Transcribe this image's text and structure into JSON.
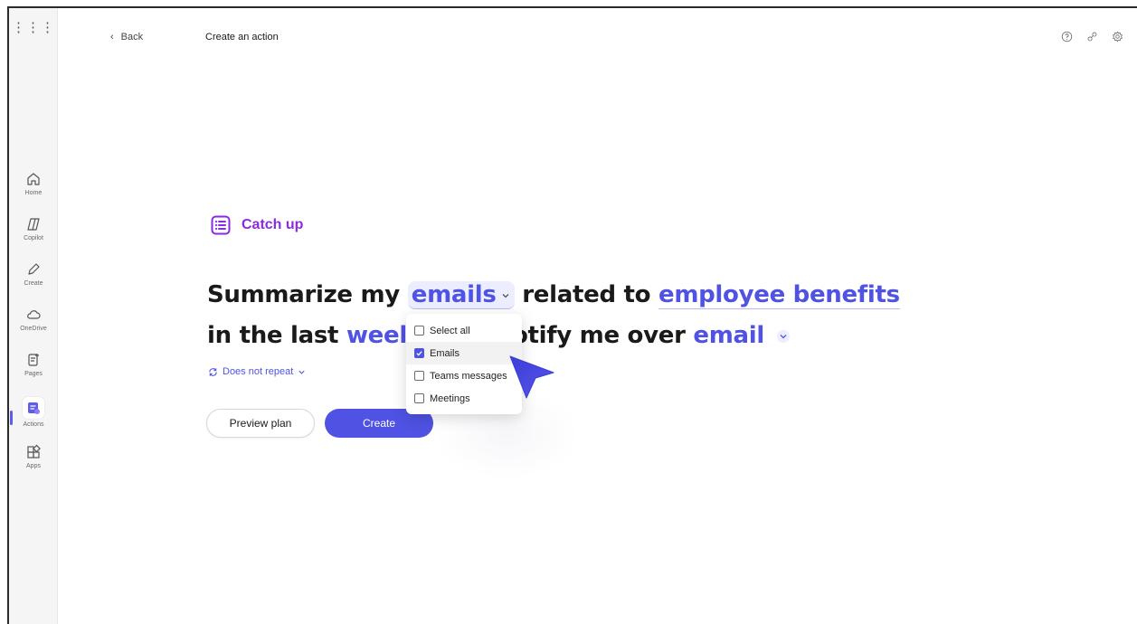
{
  "rail": {
    "items": [
      {
        "label": "Home",
        "icon": "home-icon"
      },
      {
        "label": "Copilot",
        "icon": "copilot-icon"
      },
      {
        "label": "Create",
        "icon": "pencil-icon"
      },
      {
        "label": "OneDrive",
        "icon": "cloud-icon"
      },
      {
        "label": "Pages",
        "icon": "pages-icon"
      },
      {
        "label": "Actions",
        "icon": "actions-icon"
      },
      {
        "label": "Apps",
        "icon": "apps-icon"
      }
    ]
  },
  "header": {
    "back_label": "Back",
    "title": "Create an action"
  },
  "category": {
    "label": "Catch up"
  },
  "sentence": {
    "prefix1": "Summarize my",
    "source_token": "emails",
    "middle1": "related to",
    "topic_token": "employee benefits",
    "prefix2": "in the last",
    "period_token": "weel",
    "middle2": "otify me over",
    "channel_token": "email"
  },
  "repeat": {
    "label": "Does not repeat"
  },
  "buttons": {
    "preview": "Preview plan",
    "create": "Create"
  },
  "dropdown": {
    "options": [
      {
        "label": "Select all",
        "checked": false
      },
      {
        "label": "Emails",
        "checked": true
      },
      {
        "label": "Teams messages",
        "checked": false
      },
      {
        "label": "Meetings",
        "checked": false
      }
    ]
  },
  "colors": {
    "accent": "#4f52e3",
    "category": "#8a2be2"
  }
}
